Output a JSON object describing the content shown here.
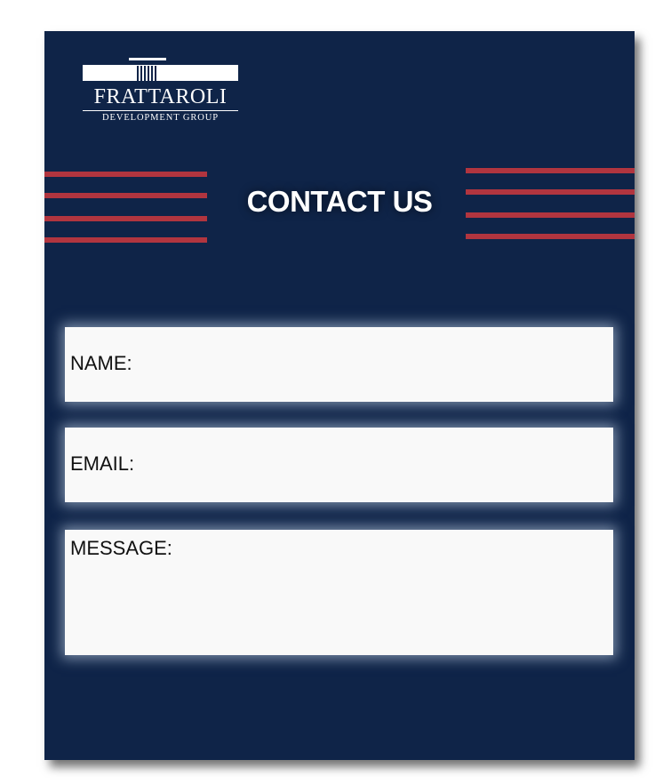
{
  "logo": {
    "company": "FRATTAROLI",
    "tagline": "DEVELOPMENT GROUP"
  },
  "heading": "CONTACT US",
  "form": {
    "name_label": "NAME:",
    "email_label": "EMAIL:",
    "message_label": "MESSAGE:"
  },
  "colors": {
    "background": "#0f2448",
    "stripe": "#b1353f",
    "field": "#f9f9f9"
  }
}
